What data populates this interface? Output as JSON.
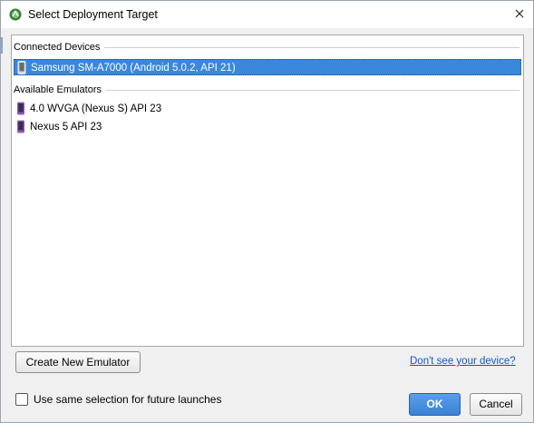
{
  "window": {
    "title": "Select Deployment Target",
    "close_label": "×"
  },
  "groups": {
    "connected": {
      "title": "Connected Devices",
      "devices": [
        {
          "label": "Samsung SM-A7000 (Android 5.0.2, API 21)",
          "icon": "phone-icon",
          "selected": true
        }
      ]
    },
    "emulators": {
      "title": "Available Emulators",
      "devices": [
        {
          "label": "4.0 WVGA (Nexus S) API 23",
          "icon": "emulator-phone-icon",
          "selected": false
        },
        {
          "label": "Nexus 5 API 23",
          "icon": "emulator-phone-icon",
          "selected": false
        }
      ]
    }
  },
  "buttons": {
    "create_emulator": "Create New Emulator",
    "ok": "OK",
    "cancel": "Cancel"
  },
  "help_link": "Don't see your device?",
  "checkbox": {
    "label": "Use same selection for future launches",
    "checked": false
  },
  "colors": {
    "selection": "#3a87dc",
    "link": "#1155cc",
    "ok_button": "#3b82d6",
    "emulator_icon": "#8a5fb4"
  }
}
